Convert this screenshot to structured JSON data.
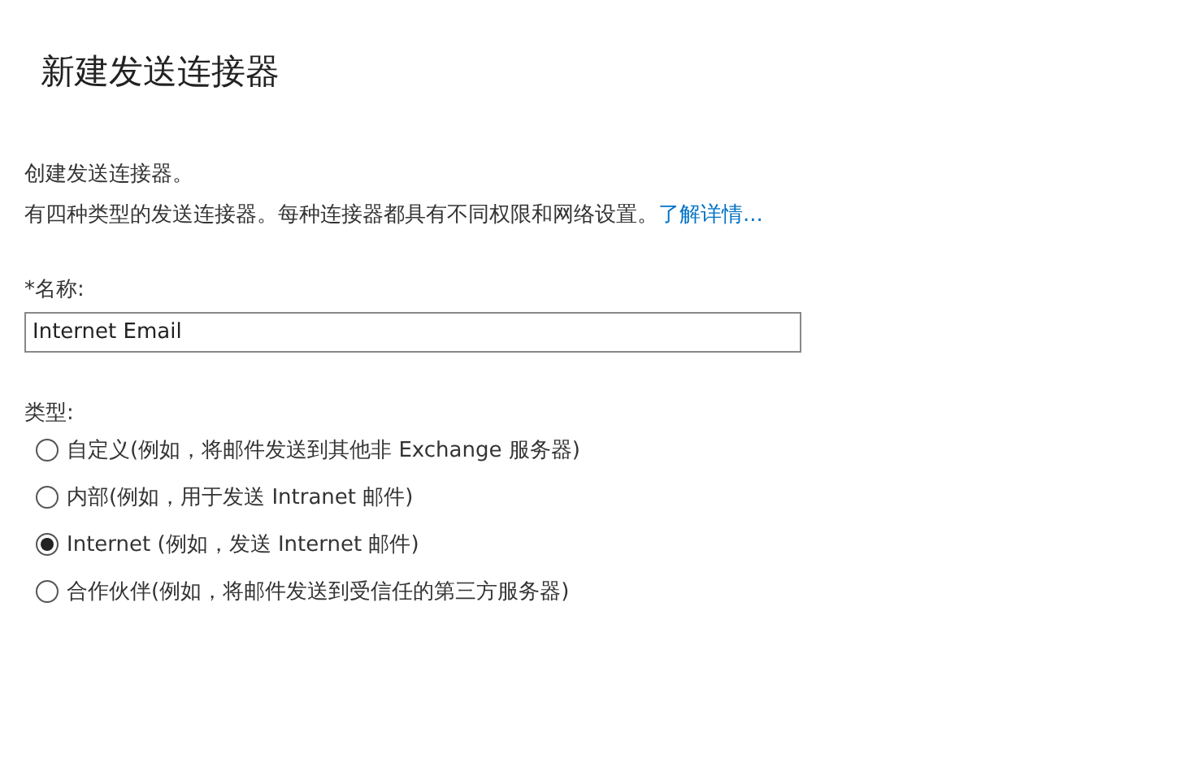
{
  "title": "新建发送连接器",
  "intro": "创建发送连接器。",
  "description": {
    "text": "有四种类型的发送连接器。每种连接器都具有不同权限和网络设置。",
    "link": "了解详情..."
  },
  "name_field": {
    "label": "*名称:",
    "value": "Internet Email"
  },
  "type_group": {
    "label": "类型:",
    "options": [
      {
        "label": "自定义(例如，将邮件发送到其他非 Exchange 服务器)",
        "selected": false
      },
      {
        "label": "内部(例如，用于发送 Intranet 邮件)",
        "selected": false
      },
      {
        "label": "Internet (例如，发送 Internet 邮件)",
        "selected": true
      },
      {
        "label": "合作伙伴(例如，将邮件发送到受信任的第三方服务器)",
        "selected": false
      }
    ]
  }
}
